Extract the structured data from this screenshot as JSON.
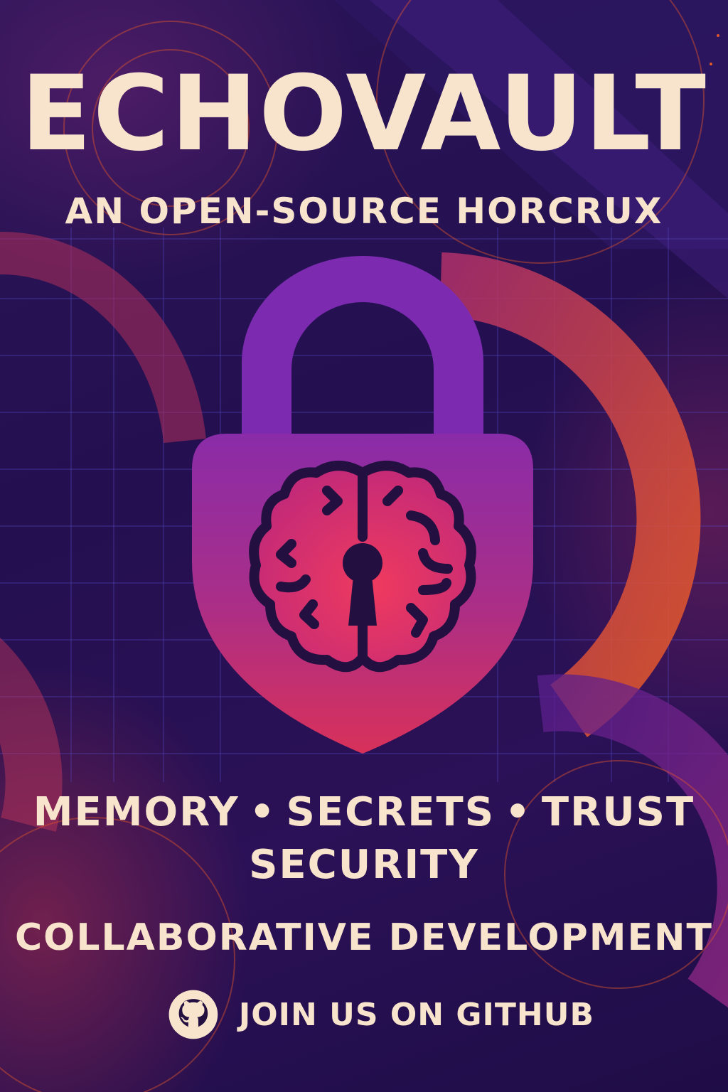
{
  "poster": {
    "title": "ECHOVAULT",
    "subtitle": "AN OPEN-SOURCE HORCRUX",
    "tagline": {
      "item1": "MEMORY",
      "separator": "•",
      "item2": "SECRETS",
      "item3": "TRUST",
      "line2": "SECURITY",
      "line3": "COLLABORATIVE DEVELOPMENT"
    },
    "cta": {
      "label": "JOIN US ON GITHUB",
      "icon": "github-icon"
    },
    "center_icon": "padlock-brain-icon"
  },
  "colors": {
    "text": "#f8e4cc",
    "background": "#241050",
    "lock_top": "#8a2ca8",
    "lock_bottom": "#d8315a",
    "outline": "#241040",
    "accent_orange": "#e0552a"
  }
}
